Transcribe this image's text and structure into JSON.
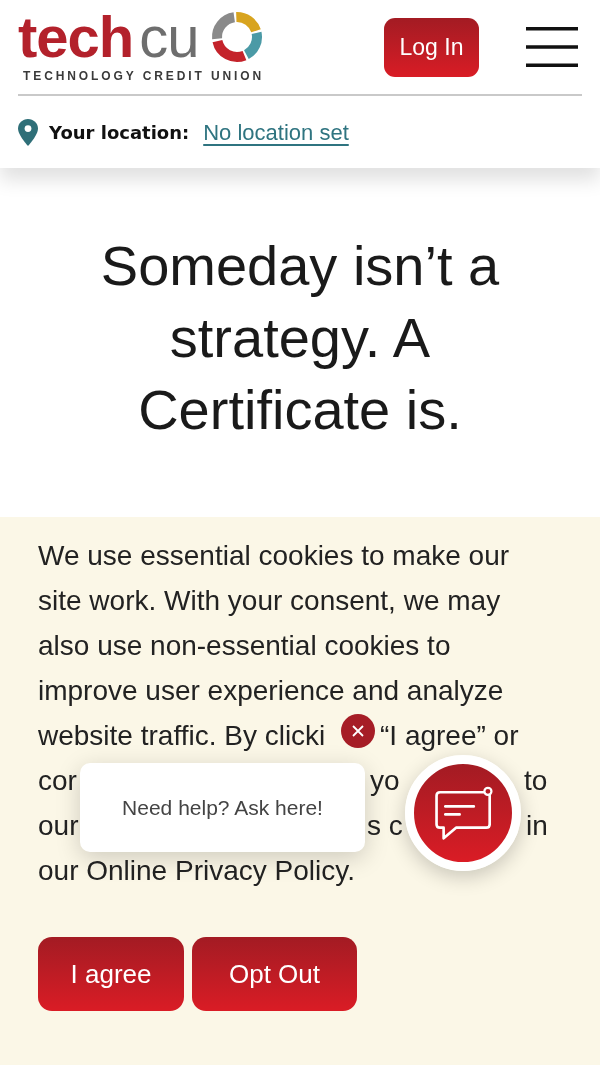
{
  "header": {
    "logo": {
      "wordmark_bold": "tech",
      "wordmark_light": "cu",
      "tagline": "TECHNOLOGY CREDIT UNION"
    },
    "login_button": "Log In",
    "location": {
      "label": "Your location:",
      "link": "No location set"
    }
  },
  "hero": {
    "heading": "Someday isn’t a strategy. A Certificate is."
  },
  "cookie_banner": {
    "lines_above": [
      "We use essential cookies to make our",
      "site work. With your consent, we may",
      "also use non-essential cookies to",
      "improve user experience and analyze"
    ],
    "covered_lines": [
      {
        "fragments": [
          "website traffic. By clicki",
          "“I agree” or"
        ]
      },
      {
        "fragments": [
          "cor",
          "yo",
          "to"
        ]
      },
      {
        "fragments": [
          "our",
          "s c",
          "in"
        ]
      }
    ],
    "last_line": "our Online Privacy Policy.",
    "buttons": [
      "I agree",
      "Opt Out"
    ]
  },
  "chat_widget": {
    "prompt": "Need help? Ask here!"
  }
}
